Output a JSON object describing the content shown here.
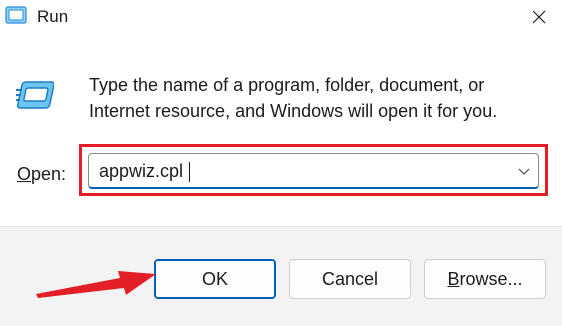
{
  "window": {
    "title": "Run",
    "title_icon": "run-icon",
    "close_icon": "close-icon"
  },
  "description": "Type the name of a program, folder, document, or Internet resource, and Windows will open it for you.",
  "open_field": {
    "label_mnemonic": "O",
    "label_rest": "pen:",
    "value": "appwiz.cpl",
    "dropdown_icon": "chevron-down-icon"
  },
  "buttons": {
    "ok": "OK",
    "cancel": "Cancel",
    "browse_mnemonic": "B",
    "browse_rest": "rowse..."
  },
  "annotations": {
    "highlight_color": "#e41e26",
    "arrow_color": "#e41e26"
  },
  "colors": {
    "accent": "#005fb8",
    "footer_bg": "#f3f3f3"
  }
}
